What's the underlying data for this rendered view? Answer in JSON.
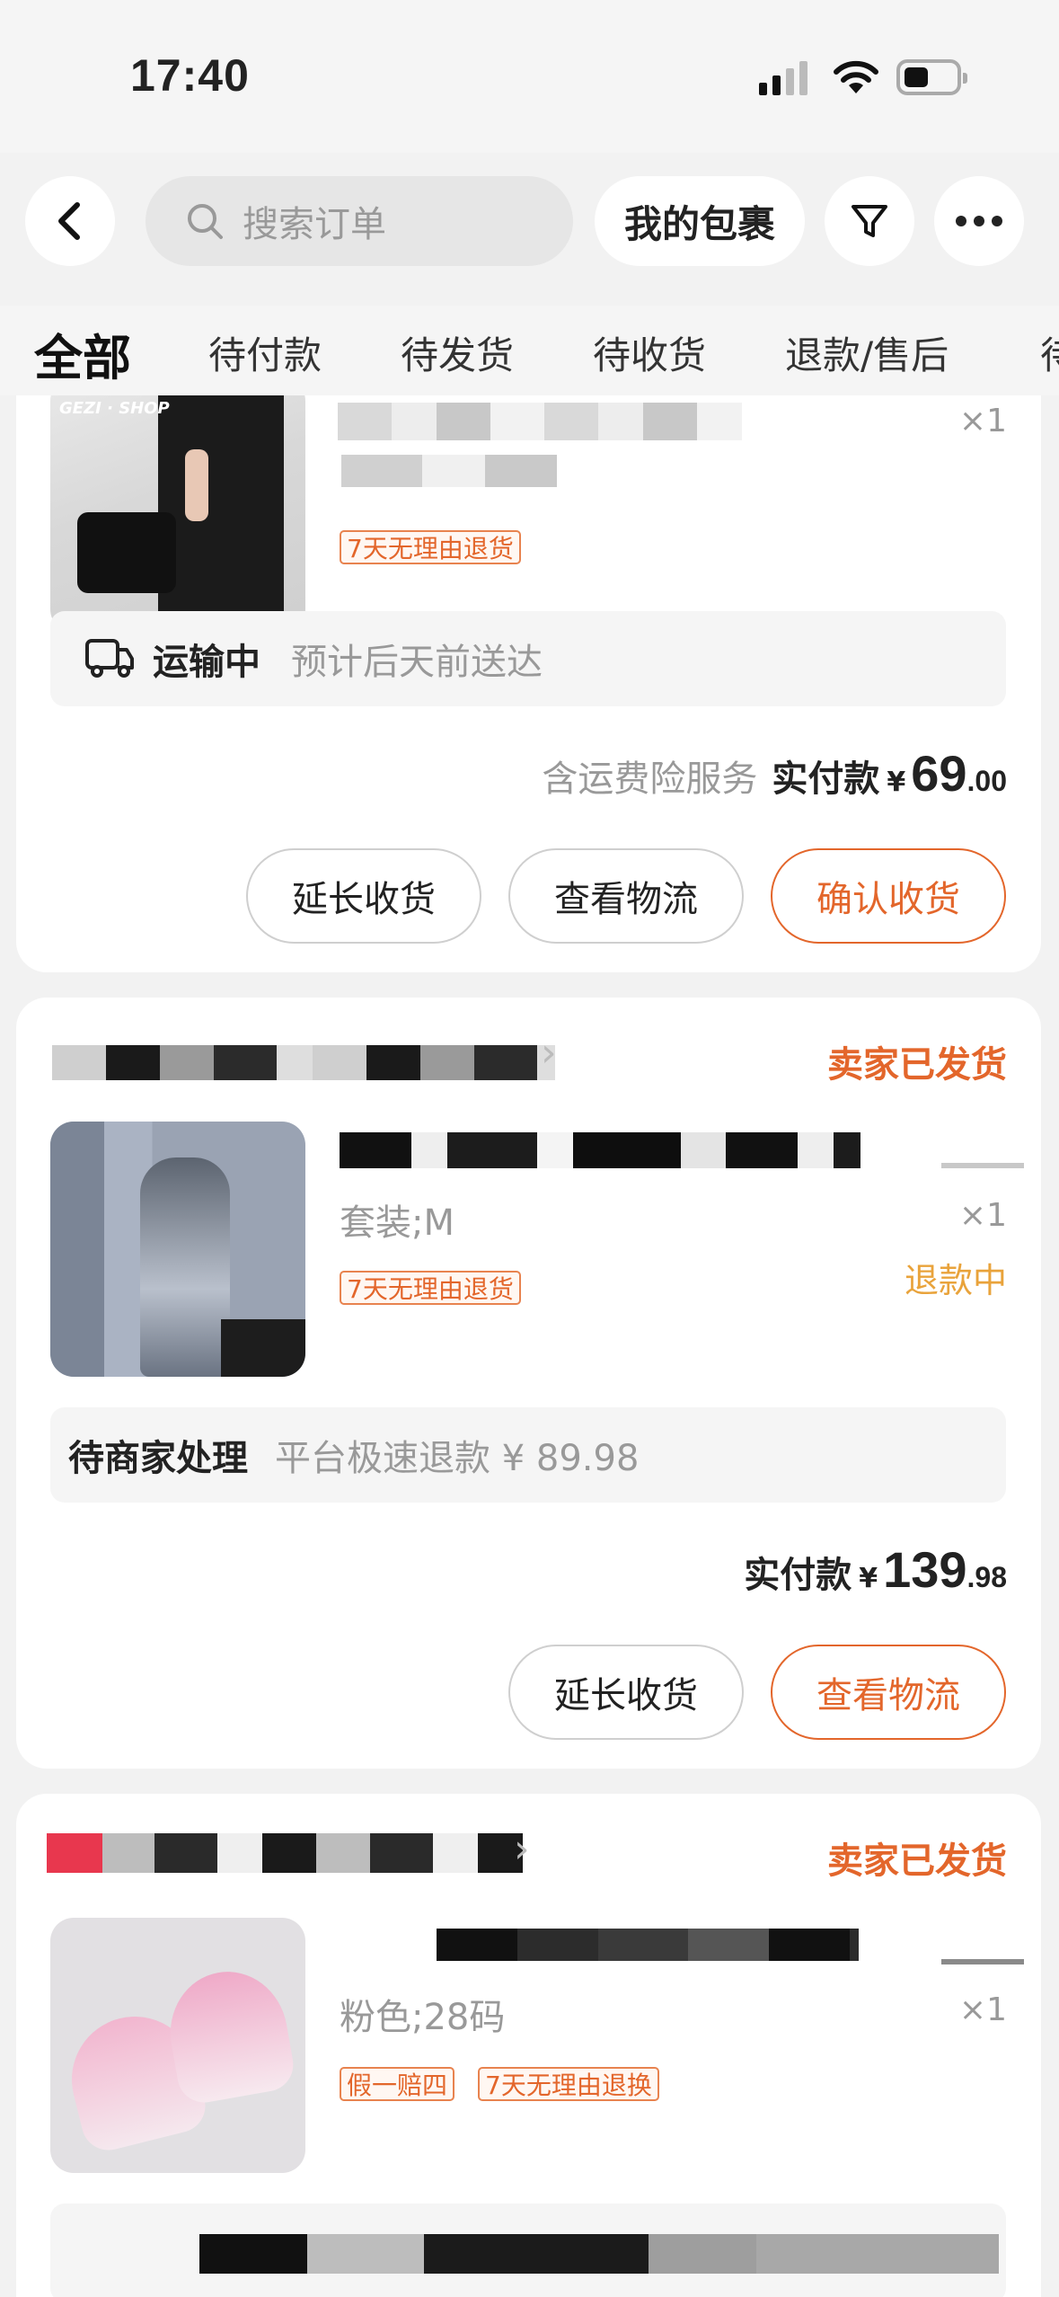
{
  "status_bar": {
    "time": "17:40"
  },
  "header": {
    "search_placeholder": "搜索订单",
    "packages_label": "我的包裹"
  },
  "tabs": [
    {
      "label": "全部"
    },
    {
      "label": "待付款"
    },
    {
      "label": "待发货"
    },
    {
      "label": "待收货"
    },
    {
      "label": "退款/售后"
    },
    {
      "label": "待"
    }
  ],
  "orders": [
    {
      "thumb_watermark": "GEZI · SHOP",
      "qty": "×1",
      "tags": [
        "7天无理由退货"
      ],
      "logistics": {
        "status": "运输中",
        "eta": "预计后天前送达"
      },
      "insurance_note": "含运费险服务",
      "paid_label": "实付款",
      "currency": "¥",
      "amount_int": "69",
      "amount_dec": ".00",
      "buttons": [
        "延长收货",
        "查看物流",
        "确认收货"
      ]
    },
    {
      "status": "卖家已发货",
      "spec": "套装;M",
      "qty": "×1",
      "refund_status": "退款中",
      "tags": [
        "7天无理由退货"
      ],
      "pending": {
        "title": "待商家处理",
        "detail": "平台极速退款 ¥ 89.98"
      },
      "paid_label": "实付款",
      "currency": "¥",
      "amount_int": "139",
      "amount_dec": ".98",
      "buttons": [
        "延长收货",
        "查看物流"
      ]
    },
    {
      "status": "卖家已发货",
      "spec": "粉色;28码",
      "qty": "×1",
      "tags": [
        "假一赔四",
        "7天无理由退换"
      ]
    }
  ],
  "colors": {
    "accent": "#e3662b",
    "background": "#f2f2f2"
  }
}
